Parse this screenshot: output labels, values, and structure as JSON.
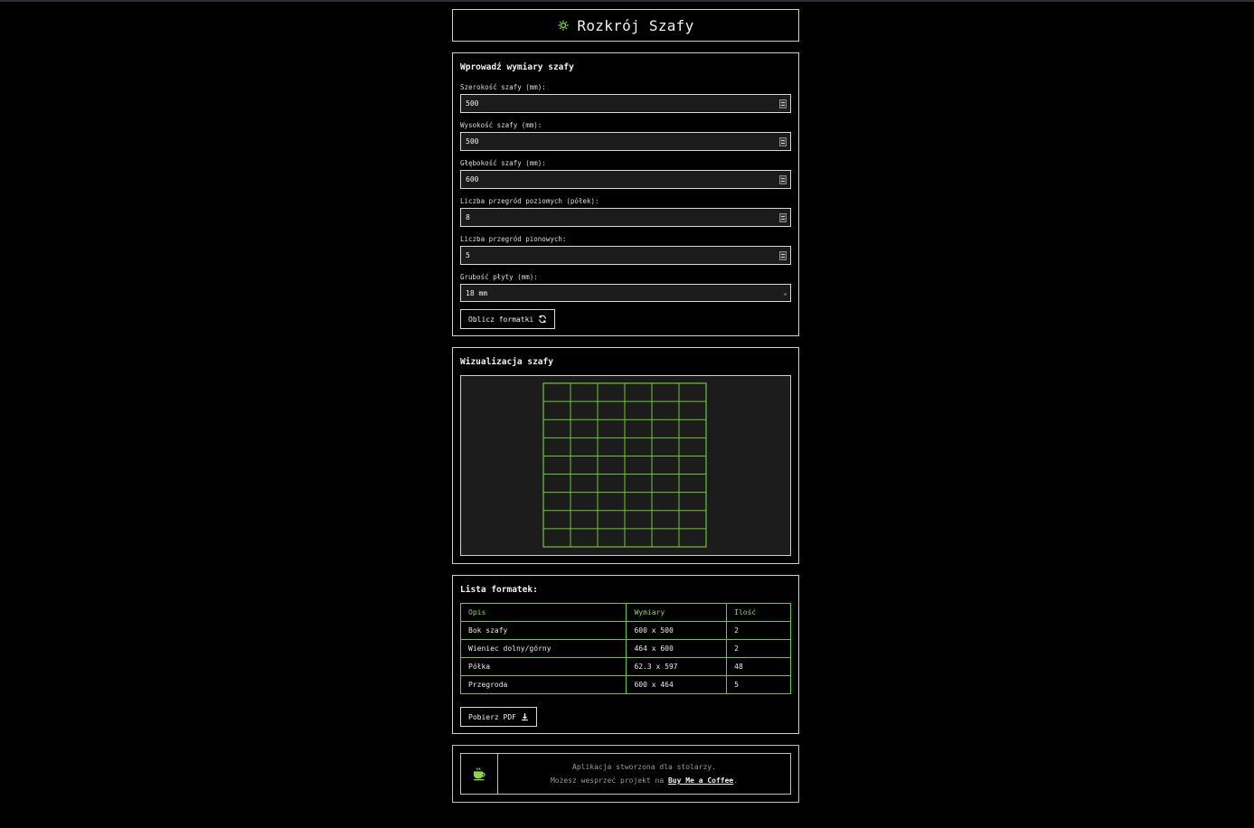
{
  "app": {
    "title": "Rozkrój Szafy",
    "accent": "#6fc43a",
    "header_icon": "gear-icon"
  },
  "form": {
    "title": "Wprowadź wymiary szafy",
    "fields": [
      {
        "label": "Szerokość szafy (mm):",
        "value": "500"
      },
      {
        "label": "Wysokość szafy (mm):",
        "value": "500"
      },
      {
        "label": "Głębokość szafy (mm):",
        "value": "600"
      },
      {
        "label": "Liczba przegród poziomych (półek):",
        "value": "8"
      },
      {
        "label": "Liczba przegród pionowych:",
        "value": "5"
      }
    ],
    "thickness": {
      "label": "Grubość płyty (mm):",
      "value": "18 mm"
    },
    "calc_button": "Oblicz formatki",
    "calc_icon": "refresh-icon"
  },
  "visualization": {
    "title": "Wizualizacja szafy",
    "columns": 6,
    "rows": 9
  },
  "list": {
    "title": "Lista formatek:",
    "headers": [
      "Opis",
      "Wymiary",
      "Ilość"
    ],
    "rows": [
      [
        "Bok szafy",
        "600 x 500",
        "2"
      ],
      [
        "Wieniec dolny/górny",
        "464 x 600",
        "2"
      ],
      [
        "Półka",
        "62.3 x 597",
        "48"
      ],
      [
        "Przegroda",
        "600 x 464",
        "5"
      ]
    ],
    "pdf_button": "Pobierz PDF",
    "pdf_icon": "download-icon"
  },
  "footer": {
    "icon": "coffee-cup-icon",
    "line1": "Aplikacja stworzona dla stolarzy.",
    "line2_prefix": "Możesz wesprzeć projekt na ",
    "link": "Buy Me a Coffee",
    "line2_suffix": "."
  }
}
